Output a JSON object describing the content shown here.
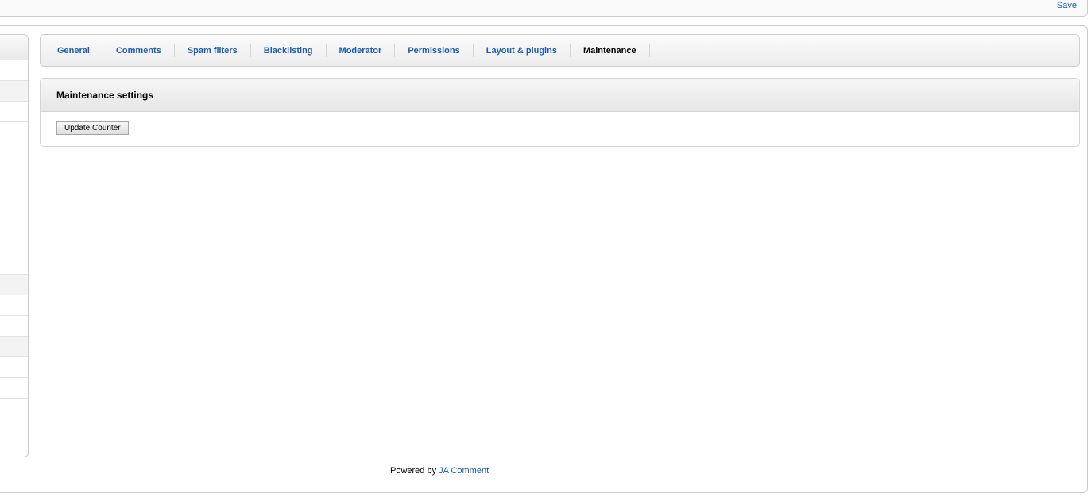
{
  "toolbar": {
    "save_label": "Save"
  },
  "tabs": [
    {
      "label": "General",
      "active": false
    },
    {
      "label": "Comments",
      "active": false
    },
    {
      "label": "Spam filters",
      "active": false
    },
    {
      "label": "Blacklisting",
      "active": false
    },
    {
      "label": "Moderator",
      "active": false
    },
    {
      "label": "Permissions",
      "active": false
    },
    {
      "label": "Layout & plugins",
      "active": false
    },
    {
      "label": "Maintenance",
      "active": true
    }
  ],
  "panel": {
    "title": "Maintenance settings",
    "update_button_label": "Update Counter"
  },
  "footer": {
    "prefix": "Powered by",
    "link_text": "JA Comment"
  },
  "colors": {
    "link": "#1a5db3",
    "border": "#cccccc"
  }
}
